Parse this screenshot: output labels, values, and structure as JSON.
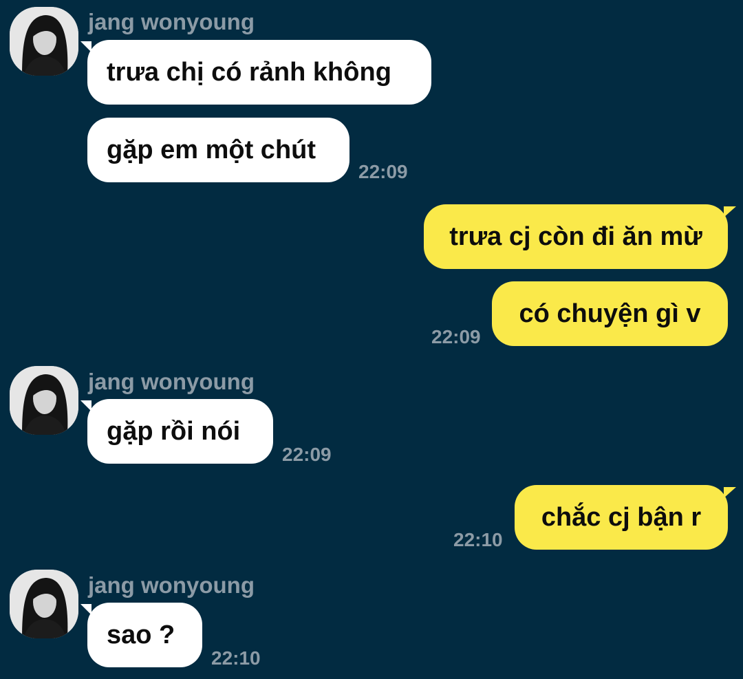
{
  "conversation": {
    "contact_name": "jang wonyoung",
    "avatar_icon": "profile-photo-avatar",
    "colors": {
      "background": "#022b41",
      "incoming_bubble": "#ffffff",
      "outgoing_bubble": "#fae94a",
      "meta_text": "#8c9ba6"
    },
    "groups": [
      {
        "direction": "incoming",
        "sender": "jang wonyoung",
        "messages": [
          "trưa chị có rảnh không",
          "gặp em một chút"
        ],
        "time": "22:09"
      },
      {
        "direction": "outgoing",
        "messages": [
          "trưa cj còn đi ăn mừ",
          "có chuyện gì v"
        ],
        "time": "22:09"
      },
      {
        "direction": "incoming",
        "sender": "jang wonyoung",
        "messages": [
          "gặp rồi nói"
        ],
        "time": "22:09"
      },
      {
        "direction": "outgoing",
        "messages": [
          "chắc cj bận r"
        ],
        "time": "22:10"
      },
      {
        "direction": "incoming",
        "sender": "jang wonyoung",
        "messages": [
          "sao ?"
        ],
        "time": "22:10"
      }
    ]
  }
}
